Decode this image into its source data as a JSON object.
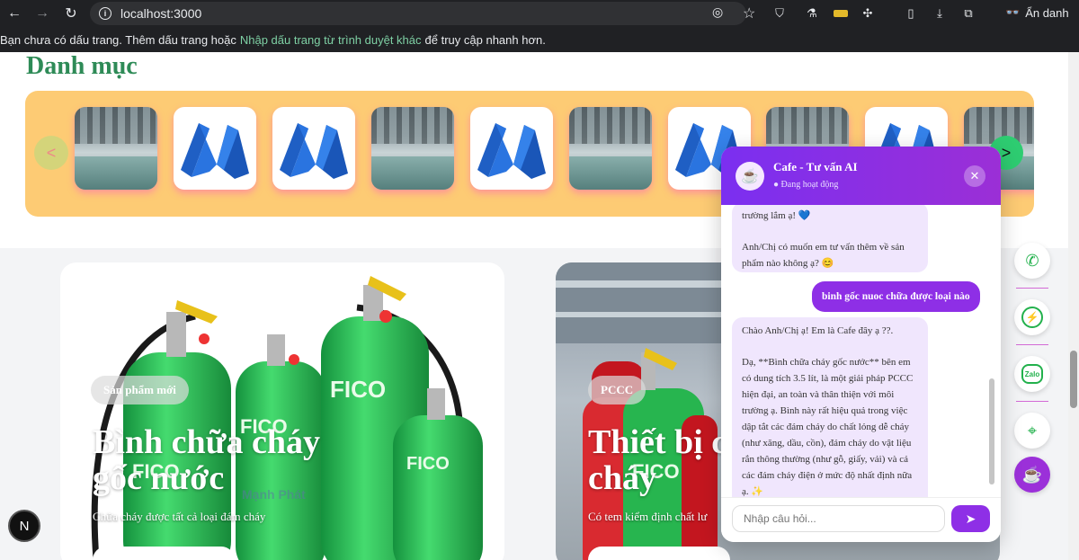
{
  "browser": {
    "url": "localhost:3000",
    "profile_label": "Ẩn danh",
    "bookmark_bar": {
      "text_before": "Bạn chưa có dấu trang. Thêm dấu trang hoặc",
      "link": "Nhập dấu trang từ trình duyệt khác",
      "text_after": "để truy cập nhanh hơn."
    }
  },
  "categories": {
    "title": "Danh mục",
    "prev_label": "<",
    "next_label": ">",
    "tiles": [
      "warehouse",
      "roof",
      "roof",
      "warehouse",
      "roof",
      "warehouse",
      "roof",
      "warehouse",
      "roof",
      "warehouse"
    ]
  },
  "cards": [
    {
      "badge": "Sản phẩm mới",
      "title_line1": "Bình chữa cháy",
      "title_line2": "gốc nước",
      "subtitle": "Chữa cháy được tất cả loại đám cháy",
      "watermark": "Mạnh Phát",
      "bottle_label": "FICO"
    },
    {
      "badge": "PCCC",
      "title_line1": "Thiết bị c",
      "title_line2": "cháy",
      "subtitle": "Có tem kiểm định chất lư",
      "bottle_label": "FICO"
    }
  ],
  "chat": {
    "title": "Cafe - Tư vấn AI",
    "status": "● Đang hoạt động",
    "messages": {
      "bot1_line1": "trường lắm ạ! 💙",
      "bot1_line2": "Anh/Chị có muốn em tư vấn thêm về sản phẩm nào không ạ? 😊",
      "user1": "binh gốc nuoc chữa được loại nào",
      "bot2_line1": "Chào Anh/Chị ạ! Em là Cafe đây ạ ??.",
      "bot2_line2": "Dạ, **Bình chữa cháy gốc nước** bên em có dung tích 3.5 lít, là một giải pháp PCCC hiện đại, an toàn và thân thiện với môi trường ạ. Bình này rất hiệu quả trong việc dập tắt các đám cháy do chất lỏng dễ cháy (như xăng, dầu, cồn), đám cháy do vật liệu rắn thông thường (như gỗ, giấy, vải) và cả các đám cháy điện ở mức độ nhất định nữa ạ. ✨"
    },
    "input_placeholder": "Nhập câu hỏi...",
    "send_icon": "send-icon"
  },
  "contacts": {
    "zalo_label": "Zalo"
  },
  "dev_badge": "N"
}
